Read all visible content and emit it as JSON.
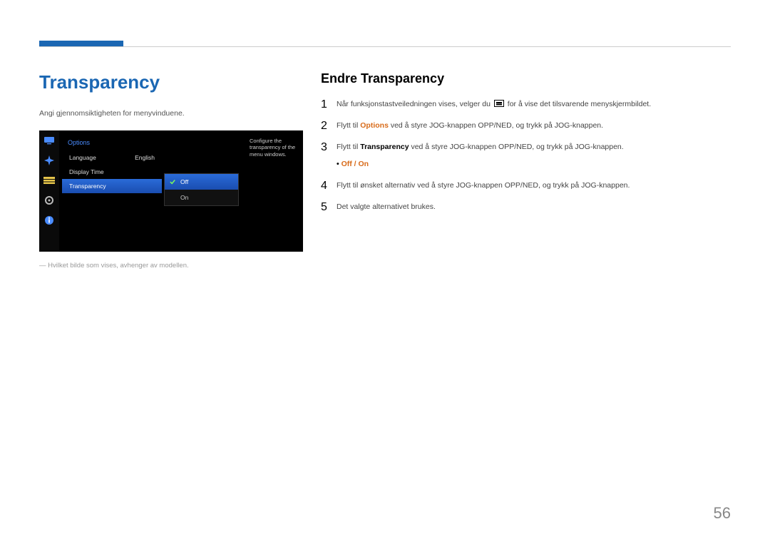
{
  "left": {
    "heading": "Transparency",
    "lead": "Angi gjennomsiktigheten for menyvinduene.",
    "footnote": "Hvilket bilde som vises, avhenger av modellen."
  },
  "osd": {
    "title": "Options",
    "rows": [
      {
        "label": "Language",
        "value": "English",
        "selected": false
      },
      {
        "label": "Display Time",
        "value": "",
        "selected": false
      },
      {
        "label": "Transparency",
        "value": "",
        "selected": true
      }
    ],
    "submenu": [
      {
        "label": "Off",
        "selected": true
      },
      {
        "label": "On",
        "selected": false
      }
    ],
    "tip": "Configure the transparency of the menu windows."
  },
  "right": {
    "heading": "Endre Transparency",
    "steps": {
      "n1": "1",
      "s1a": "Når funksjonstastveiledningen vises, velger du ",
      "s1b": " for å vise det tilsvarende menyskjermbildet.",
      "n2": "2",
      "s2a": "Flytt til ",
      "s2opt": "Options",
      "s2b": " ved å styre JOG-knappen OPP/NED, og trykk på JOG-knappen.",
      "n3": "3",
      "s3a": "Flytt til ",
      "s3tr": "Transparency",
      "s3b": " ved å styre JOG-knappen OPP/NED, og trykk på JOG-knappen.",
      "s3bullet": "Off / On",
      "n4": "4",
      "s4": "Flytt til ønsket alternativ ved å styre JOG-knappen OPP/NED, og trykk på JOG-knappen.",
      "n5": "5",
      "s5": "Det valgte alternativet brukes."
    }
  },
  "page": "56"
}
